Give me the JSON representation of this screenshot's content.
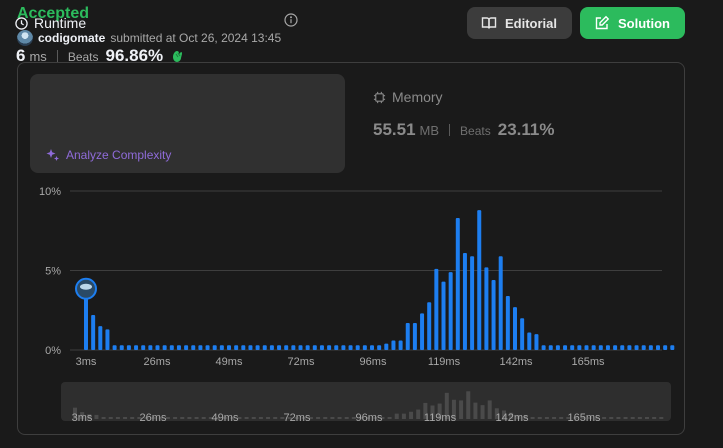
{
  "header": {
    "status": "Accepted",
    "username": "codigomate",
    "submitted_text": "submitted at Oct 26, 2024 13:45",
    "editorial_label": "Editorial",
    "solution_label": "Solution"
  },
  "runtime": {
    "title": "Runtime",
    "value": "6",
    "unit": "ms",
    "beats_label": "Beats",
    "beats_value": "96.86%",
    "analyze_label": "Analyze Complexity"
  },
  "memory": {
    "title": "Memory",
    "value": "55.51",
    "unit": "MB",
    "beats_label": "Beats",
    "beats_value": "23.11%"
  },
  "colors": {
    "accepted": "#2cbb5d",
    "bar": "#1d7ef0",
    "analyze": "#8f6bd9"
  },
  "chart_data": {
    "type": "bar",
    "y_ticks": [
      "10%",
      "5%",
      "0%"
    ],
    "ylim": [
      0,
      10
    ],
    "x_tick_labels": [
      "3ms",
      "26ms",
      "49ms",
      "72ms",
      "96ms",
      "119ms",
      "142ms",
      "165ms"
    ],
    "highlighted_bar_index": 0,
    "values": [
      3.6,
      2.2,
      1.5,
      1.3,
      0.3,
      0.3,
      0.3,
      0.3,
      0.3,
      0.3,
      0.3,
      0.3,
      0.3,
      0.3,
      0.3,
      0.3,
      0.3,
      0.3,
      0.3,
      0.3,
      0.3,
      0.3,
      0.3,
      0.3,
      0.3,
      0.3,
      0.3,
      0.3,
      0.3,
      0.3,
      0.3,
      0.3,
      0.3,
      0.3,
      0.3,
      0.3,
      0.3,
      0.3,
      0.3,
      0.3,
      0.3,
      0.3,
      0.4,
      0.6,
      0.6,
      1.7,
      1.7,
      2.3,
      3.0,
      5.1,
      4.3,
      4.9,
      8.3,
      6.1,
      5.9,
      8.8,
      5.2,
      4.4,
      5.9,
      3.4,
      2.7,
      2.0,
      1.1,
      1.0,
      0.3,
      0.3,
      0.3,
      0.3,
      0.3,
      0.3,
      0.3,
      0.3,
      0.3,
      0.3,
      0.3,
      0.3,
      0.3,
      0.3,
      0.3,
      0.3,
      0.3,
      0.3,
      0.3
    ]
  }
}
